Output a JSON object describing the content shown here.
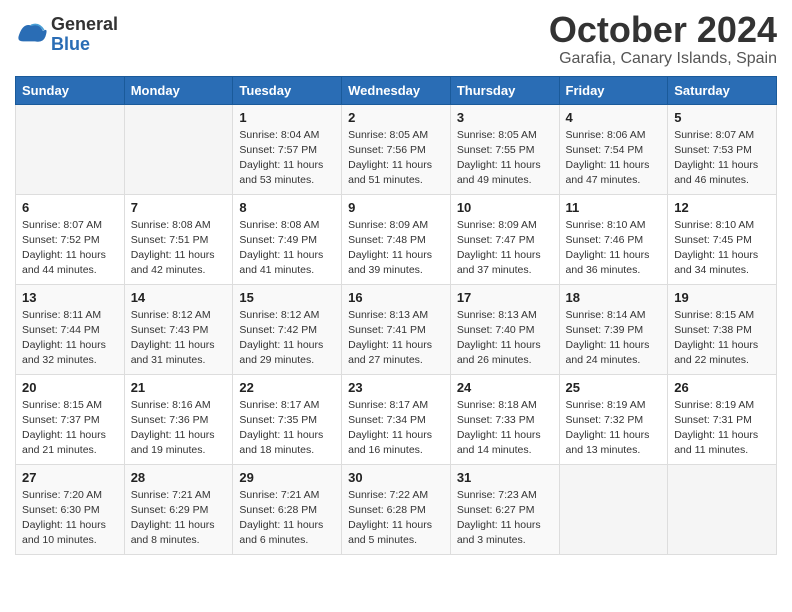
{
  "logo": {
    "general": "General",
    "blue": "Blue"
  },
  "title": "October 2024",
  "subtitle": "Garafia, Canary Islands, Spain",
  "weekdays": [
    "Sunday",
    "Monday",
    "Tuesday",
    "Wednesday",
    "Thursday",
    "Friday",
    "Saturday"
  ],
  "weeks": [
    [
      {
        "day": "",
        "sunrise": "",
        "sunset": "",
        "daylight": ""
      },
      {
        "day": "",
        "sunrise": "",
        "sunset": "",
        "daylight": ""
      },
      {
        "day": "1",
        "sunrise": "Sunrise: 8:04 AM",
        "sunset": "Sunset: 7:57 PM",
        "daylight": "Daylight: 11 hours and 53 minutes."
      },
      {
        "day": "2",
        "sunrise": "Sunrise: 8:05 AM",
        "sunset": "Sunset: 7:56 PM",
        "daylight": "Daylight: 11 hours and 51 minutes."
      },
      {
        "day": "3",
        "sunrise": "Sunrise: 8:05 AM",
        "sunset": "Sunset: 7:55 PM",
        "daylight": "Daylight: 11 hours and 49 minutes."
      },
      {
        "day": "4",
        "sunrise": "Sunrise: 8:06 AM",
        "sunset": "Sunset: 7:54 PM",
        "daylight": "Daylight: 11 hours and 47 minutes."
      },
      {
        "day": "5",
        "sunrise": "Sunrise: 8:07 AM",
        "sunset": "Sunset: 7:53 PM",
        "daylight": "Daylight: 11 hours and 46 minutes."
      }
    ],
    [
      {
        "day": "6",
        "sunrise": "Sunrise: 8:07 AM",
        "sunset": "Sunset: 7:52 PM",
        "daylight": "Daylight: 11 hours and 44 minutes."
      },
      {
        "day": "7",
        "sunrise": "Sunrise: 8:08 AM",
        "sunset": "Sunset: 7:51 PM",
        "daylight": "Daylight: 11 hours and 42 minutes."
      },
      {
        "day": "8",
        "sunrise": "Sunrise: 8:08 AM",
        "sunset": "Sunset: 7:49 PM",
        "daylight": "Daylight: 11 hours and 41 minutes."
      },
      {
        "day": "9",
        "sunrise": "Sunrise: 8:09 AM",
        "sunset": "Sunset: 7:48 PM",
        "daylight": "Daylight: 11 hours and 39 minutes."
      },
      {
        "day": "10",
        "sunrise": "Sunrise: 8:09 AM",
        "sunset": "Sunset: 7:47 PM",
        "daylight": "Daylight: 11 hours and 37 minutes."
      },
      {
        "day": "11",
        "sunrise": "Sunrise: 8:10 AM",
        "sunset": "Sunset: 7:46 PM",
        "daylight": "Daylight: 11 hours and 36 minutes."
      },
      {
        "day": "12",
        "sunrise": "Sunrise: 8:10 AM",
        "sunset": "Sunset: 7:45 PM",
        "daylight": "Daylight: 11 hours and 34 minutes."
      }
    ],
    [
      {
        "day": "13",
        "sunrise": "Sunrise: 8:11 AM",
        "sunset": "Sunset: 7:44 PM",
        "daylight": "Daylight: 11 hours and 32 minutes."
      },
      {
        "day": "14",
        "sunrise": "Sunrise: 8:12 AM",
        "sunset": "Sunset: 7:43 PM",
        "daylight": "Daylight: 11 hours and 31 minutes."
      },
      {
        "day": "15",
        "sunrise": "Sunrise: 8:12 AM",
        "sunset": "Sunset: 7:42 PM",
        "daylight": "Daylight: 11 hours and 29 minutes."
      },
      {
        "day": "16",
        "sunrise": "Sunrise: 8:13 AM",
        "sunset": "Sunset: 7:41 PM",
        "daylight": "Daylight: 11 hours and 27 minutes."
      },
      {
        "day": "17",
        "sunrise": "Sunrise: 8:13 AM",
        "sunset": "Sunset: 7:40 PM",
        "daylight": "Daylight: 11 hours and 26 minutes."
      },
      {
        "day": "18",
        "sunrise": "Sunrise: 8:14 AM",
        "sunset": "Sunset: 7:39 PM",
        "daylight": "Daylight: 11 hours and 24 minutes."
      },
      {
        "day": "19",
        "sunrise": "Sunrise: 8:15 AM",
        "sunset": "Sunset: 7:38 PM",
        "daylight": "Daylight: 11 hours and 22 minutes."
      }
    ],
    [
      {
        "day": "20",
        "sunrise": "Sunrise: 8:15 AM",
        "sunset": "Sunset: 7:37 PM",
        "daylight": "Daylight: 11 hours and 21 minutes."
      },
      {
        "day": "21",
        "sunrise": "Sunrise: 8:16 AM",
        "sunset": "Sunset: 7:36 PM",
        "daylight": "Daylight: 11 hours and 19 minutes."
      },
      {
        "day": "22",
        "sunrise": "Sunrise: 8:17 AM",
        "sunset": "Sunset: 7:35 PM",
        "daylight": "Daylight: 11 hours and 18 minutes."
      },
      {
        "day": "23",
        "sunrise": "Sunrise: 8:17 AM",
        "sunset": "Sunset: 7:34 PM",
        "daylight": "Daylight: 11 hours and 16 minutes."
      },
      {
        "day": "24",
        "sunrise": "Sunrise: 8:18 AM",
        "sunset": "Sunset: 7:33 PM",
        "daylight": "Daylight: 11 hours and 14 minutes."
      },
      {
        "day": "25",
        "sunrise": "Sunrise: 8:19 AM",
        "sunset": "Sunset: 7:32 PM",
        "daylight": "Daylight: 11 hours and 13 minutes."
      },
      {
        "day": "26",
        "sunrise": "Sunrise: 8:19 AM",
        "sunset": "Sunset: 7:31 PM",
        "daylight": "Daylight: 11 hours and 11 minutes."
      }
    ],
    [
      {
        "day": "27",
        "sunrise": "Sunrise: 7:20 AM",
        "sunset": "Sunset: 6:30 PM",
        "daylight": "Daylight: 11 hours and 10 minutes."
      },
      {
        "day": "28",
        "sunrise": "Sunrise: 7:21 AM",
        "sunset": "Sunset: 6:29 PM",
        "daylight": "Daylight: 11 hours and 8 minutes."
      },
      {
        "day": "29",
        "sunrise": "Sunrise: 7:21 AM",
        "sunset": "Sunset: 6:28 PM",
        "daylight": "Daylight: 11 hours and 6 minutes."
      },
      {
        "day": "30",
        "sunrise": "Sunrise: 7:22 AM",
        "sunset": "Sunset: 6:28 PM",
        "daylight": "Daylight: 11 hours and 5 minutes."
      },
      {
        "day": "31",
        "sunrise": "Sunrise: 7:23 AM",
        "sunset": "Sunset: 6:27 PM",
        "daylight": "Daylight: 11 hours and 3 minutes."
      },
      {
        "day": "",
        "sunrise": "",
        "sunset": "",
        "daylight": ""
      },
      {
        "day": "",
        "sunrise": "",
        "sunset": "",
        "daylight": ""
      }
    ]
  ]
}
